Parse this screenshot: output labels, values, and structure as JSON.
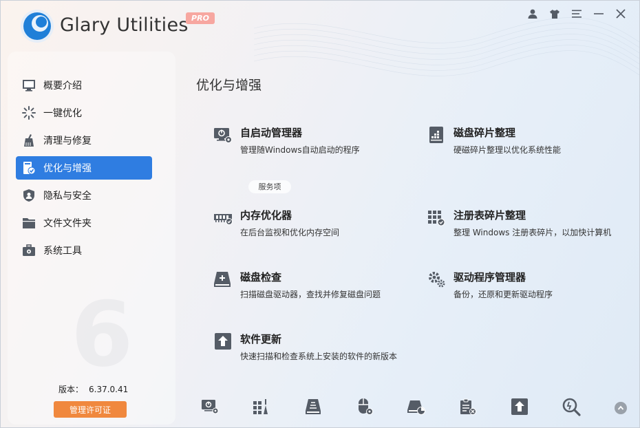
{
  "app": {
    "title": "Glary Utilities",
    "badge": "PRO"
  },
  "window_controls": [
    {
      "name": "account-icon"
    },
    {
      "name": "skin-icon"
    },
    {
      "name": "menu-icon"
    },
    {
      "name": "minimize-icon"
    },
    {
      "name": "close-icon"
    }
  ],
  "sidebar": {
    "items": [
      {
        "label": "概要介绍",
        "icon": "monitor-icon"
      },
      {
        "label": "一键优化",
        "icon": "sparkle-icon"
      },
      {
        "label": "清理与修复",
        "icon": "broom-icon"
      },
      {
        "label": "优化与增强",
        "icon": "optimize-icon",
        "active": true
      },
      {
        "label": "隐私与安全",
        "icon": "shield-icon"
      },
      {
        "label": "文件文件夹",
        "icon": "folder-icon"
      },
      {
        "label": "系统工具",
        "icon": "toolbox-icon"
      }
    ],
    "version_label": "版本：",
    "version_value": "6.37.0.41",
    "license_button": "管理许可证"
  },
  "main": {
    "section_title": "优化与增强",
    "service_tag": "服务项",
    "tools": [
      {
        "name": "自启动管理器",
        "desc": "管理随Windows自动启动的程序",
        "icon": "startup-manager-icon"
      },
      {
        "name": "磁盘碎片整理",
        "desc": "硬磁碎片整理以优化系统性能",
        "icon": "disk-defrag-icon"
      },
      {
        "name": "内存优化器",
        "desc": "在后台监视和优化内存空间",
        "icon": "memory-icon"
      },
      {
        "name": "注册表碎片整理",
        "desc": "整理 Windows 注册表碎片，以加快计算机",
        "icon": "registry-defrag-icon"
      },
      {
        "name": "磁盘检查",
        "desc": "扫描磁盘驱动器，查找并修复磁盘问题",
        "icon": "disk-check-icon"
      },
      {
        "name": "驱动程序管理器",
        "desc": "备份，还原和更新驱动程序",
        "icon": "driver-manager-icon"
      },
      {
        "name": "软件更新",
        "desc": "快速扫描和检查系统上安装的软件的新版本",
        "icon": "software-update-icon"
      }
    ]
  },
  "bottom_toolbar": [
    "startup-manager-icon",
    "registry-icon",
    "disk-cleaner-icon",
    "mouse-privacy-icon",
    "disk-space-icon",
    "uninstall-icon",
    "update-icon",
    "search-icon"
  ],
  "colors": {
    "accent": "#2f7de1",
    "license": "#f0883e",
    "icon": "#555c66"
  }
}
